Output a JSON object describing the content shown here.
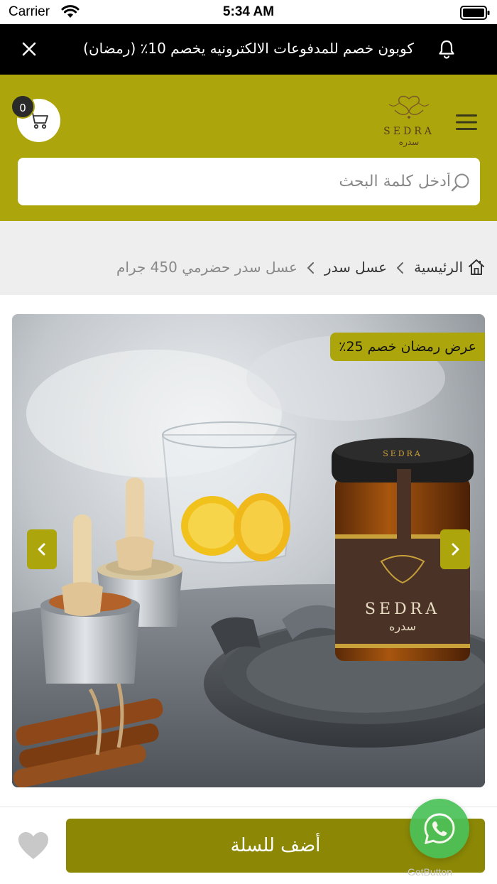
{
  "status_bar": {
    "carrier": "Carrier",
    "time": "5:34 AM"
  },
  "announcement": {
    "text": "كوبون خصم للمدفوعات الالكترونيه يخصم 10٪ (رمضان)"
  },
  "header": {
    "cart_count": "0",
    "logo_text_en": "SEDRA",
    "logo_text_ar": "سدره",
    "search_placeholder": "أدخل كلمة البحث"
  },
  "breadcrumb": {
    "home": "الرئيسية",
    "category": "عسل سدر",
    "current": "عسل سدر حضرمي 450 جرام"
  },
  "product": {
    "offer_badge": "عرض رمضان خصم 25٪",
    "jar_label_en": "SEDRA",
    "jar_label_ar": "سدره",
    "lid_label": "SEDRA"
  },
  "actions": {
    "add_to_cart": "أضف للسلة",
    "widget_label": "GetButton"
  },
  "colors": {
    "brand": "#aca60c",
    "button": "#8c8806",
    "whatsapp": "#4bc25a"
  }
}
